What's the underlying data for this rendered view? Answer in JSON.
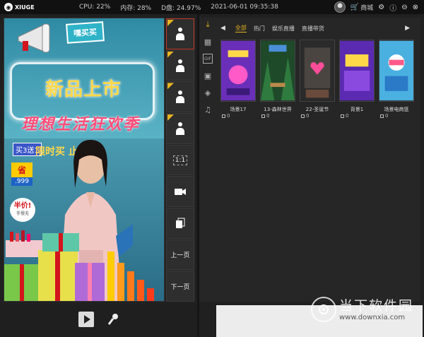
{
  "app": {
    "logo_text": "XIUGE"
  },
  "stats": {
    "cpu": "CPU: 22%",
    "memory": "内存: 28%",
    "disk": "D盘: 24.97%",
    "datetime": "2021-06-01 09:35:38"
  },
  "top_right": {
    "shop_label": "商城"
  },
  "preview": {
    "top_sign": "嘿买买",
    "title_big": "新品上市",
    "title_sub": "理想生活狂欢季",
    "badge_buy": "买3送1",
    "deal_text": "限时买  止5折",
    "sale_tag_top": "省",
    "sale_tag_price": ".999",
    "half_price": "半价!",
    "half_price_small": "手慢无"
  },
  "toolbar": {
    "ratio_label": "1:1",
    "prev_page": "上一页",
    "next_page": "下一页"
  },
  "tabs": [
    {
      "label": "全部",
      "active": true
    },
    {
      "label": "热门",
      "active": false
    },
    {
      "label": "娱乐直播",
      "active": false
    },
    {
      "label": "直播带货",
      "active": false
    }
  ],
  "scenes": [
    {
      "name": "场景17",
      "count": "0",
      "thumb": "purple-618"
    },
    {
      "name": "13-森林世界",
      "count": "0",
      "thumb": "forest"
    },
    {
      "name": "22-圣诞节",
      "count": "0",
      "thumb": "heart-neon"
    },
    {
      "name": "背景1",
      "count": "0",
      "thumb": "purple-double11"
    },
    {
      "name": "场景电商篮",
      "count": "0",
      "thumb": "blue-ecommerce"
    }
  ],
  "watermark": {
    "text": "当下软件园",
    "url": "www.downxia.com"
  },
  "colors": {
    "accent": "#e6b422",
    "active_border": "#c23b2a"
  }
}
